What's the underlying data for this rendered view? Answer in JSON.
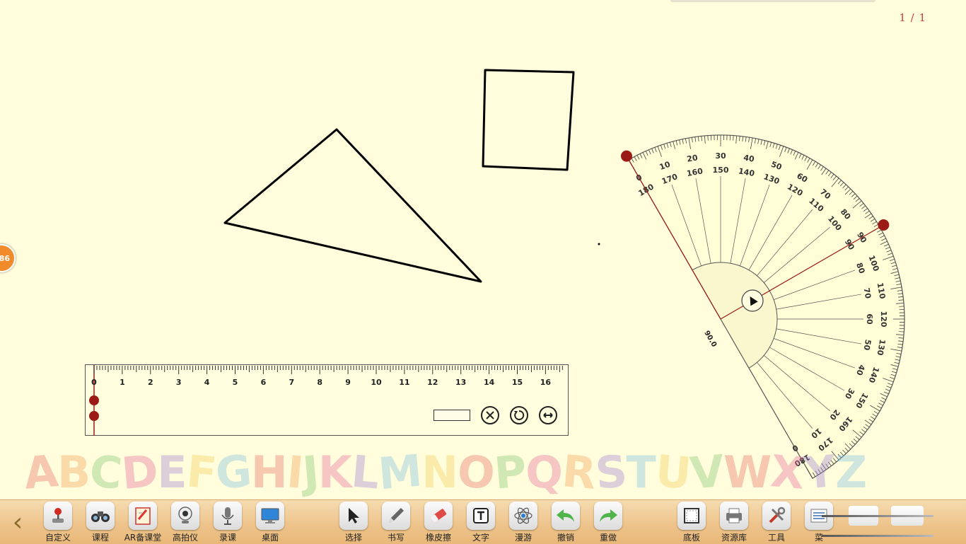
{
  "page": {
    "indicator": "1 / 1",
    "side_badge": "86"
  },
  "ruler": {
    "ticks": [
      "0",
      "1",
      "2",
      "3",
      "4",
      "5",
      "6",
      "7",
      "8",
      "9",
      "10",
      "11",
      "12",
      "13",
      "14",
      "15",
      "16"
    ],
    "value": "",
    "buttons": {
      "close": "close",
      "rotate": "rotate",
      "flip": "flip"
    }
  },
  "protractor": {
    "outer_scale": [
      "0",
      "10",
      "20",
      "30",
      "40",
      "50",
      "60",
      "70",
      "80",
      "90",
      "100",
      "110",
      "120",
      "130",
      "140",
      "150",
      "160",
      "170",
      "180"
    ],
    "inner_scale": [
      "180",
      "170",
      "160",
      "150",
      "140",
      "130",
      "120",
      "110",
      "100",
      "90",
      "80",
      "70",
      "60",
      "50",
      "40",
      "30",
      "20",
      "10",
      "0"
    ],
    "angle_readout": "90.0"
  },
  "alphabet": {
    "letters": [
      "A",
      "B",
      "C",
      "D",
      "E",
      "F",
      "G",
      "H",
      "I",
      "J",
      "K",
      "L",
      "M",
      "N",
      "O",
      "P",
      "Q",
      "R",
      "S",
      "T",
      "U",
      "V",
      "W",
      "X",
      "Y",
      "Z"
    ],
    "colors": [
      "#e8736d",
      "#f2a35a",
      "#86c773",
      "#e86fa0",
      "#a686d8",
      "#f3cf5f",
      "#7fc1e4",
      "#e8736d",
      "#f2a35a",
      "#86c773",
      "#e86fa0",
      "#a686d8",
      "#7fc1e4",
      "#f3cf5f",
      "#e8736d",
      "#86c773",
      "#e86fa0",
      "#f2a35a",
      "#a686d8",
      "#7fc1e4",
      "#f3cf5f",
      "#86c773",
      "#e8736d",
      "#e86fa0",
      "#a686d8",
      "#7fc1e4"
    ]
  },
  "toolbar": {
    "back": "‹",
    "items": [
      {
        "label": "自定义",
        "icon": "joystick-icon"
      },
      {
        "label": "课程",
        "icon": "binoculars-icon"
      },
      {
        "label": "AR备课堂",
        "icon": "lesson-book-icon"
      },
      {
        "label": "高拍仪",
        "icon": "webcam-icon"
      },
      {
        "label": "录课",
        "icon": "microphone-icon"
      },
      {
        "label": "桌面",
        "icon": "monitor-icon"
      },
      {
        "label": "选择",
        "icon": "cursor-icon"
      },
      {
        "label": "书写",
        "icon": "pen-icon"
      },
      {
        "label": "橡皮擦",
        "icon": "eraser-icon"
      },
      {
        "label": "文字",
        "icon": "text-icon"
      },
      {
        "label": "漫游",
        "icon": "atom-icon"
      },
      {
        "label": "撤销",
        "icon": "undo-icon"
      },
      {
        "label": "重做",
        "icon": "redo-icon"
      },
      {
        "label": "底板",
        "icon": "board-icon"
      },
      {
        "label": "资源库",
        "icon": "printer-icon"
      },
      {
        "label": "工具",
        "icon": "tools-icon"
      },
      {
        "label": "菜",
        "icon": "menu-icon"
      }
    ]
  },
  "colors": {
    "accent_red": "#9c1a16",
    "page_bg": "#fffddb",
    "toolbar_bg": "#eec48c",
    "undo_green": "#4fb44a"
  }
}
